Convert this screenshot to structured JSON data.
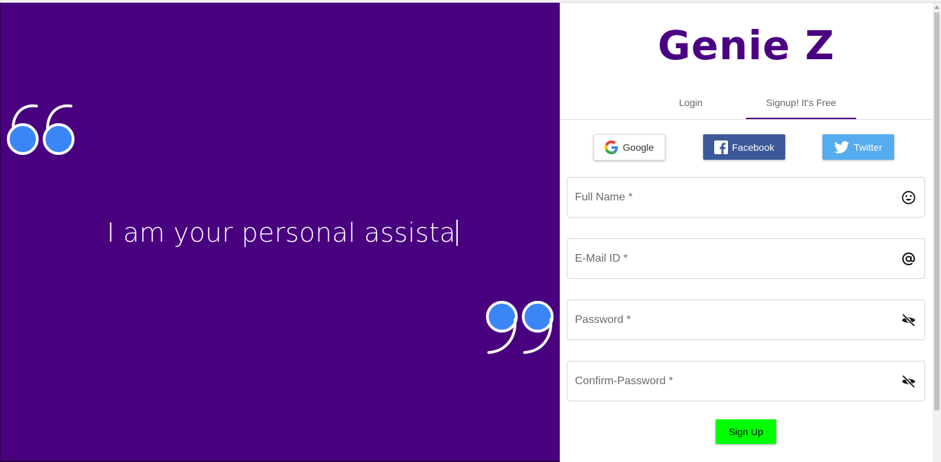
{
  "hero": {
    "typed_text": "I am your personal assista"
  },
  "brand": {
    "name": "Genie Z",
    "color": "#4b0082"
  },
  "tabs": [
    {
      "label": "Login",
      "active": false
    },
    {
      "label": "Signup! It's Free",
      "active": true
    }
  ],
  "social": {
    "google_label": "Google",
    "facebook_label": "Facebook",
    "twitter_label": "Twitter"
  },
  "form": {
    "full_name_placeholder": "Full Name *",
    "email_placeholder": "E-Mail ID *",
    "password_placeholder": "Password *",
    "confirm_password_placeholder": "Confirm-Password *",
    "submit_label": "Sign Up"
  },
  "icons": {
    "quote_open": "quote-open-icon",
    "quote_close": "quote-close-icon",
    "full_name": "smiley-icon",
    "email": "at-sign-icon",
    "password": "eye-off-icon",
    "confirm_password": "eye-off-icon"
  },
  "colors": {
    "left_panel": "#48007f",
    "quote_dots": "#3b86f7",
    "signup_button": "#00ff00",
    "facebook": "#3b5998",
    "twitter": "#55acee"
  }
}
